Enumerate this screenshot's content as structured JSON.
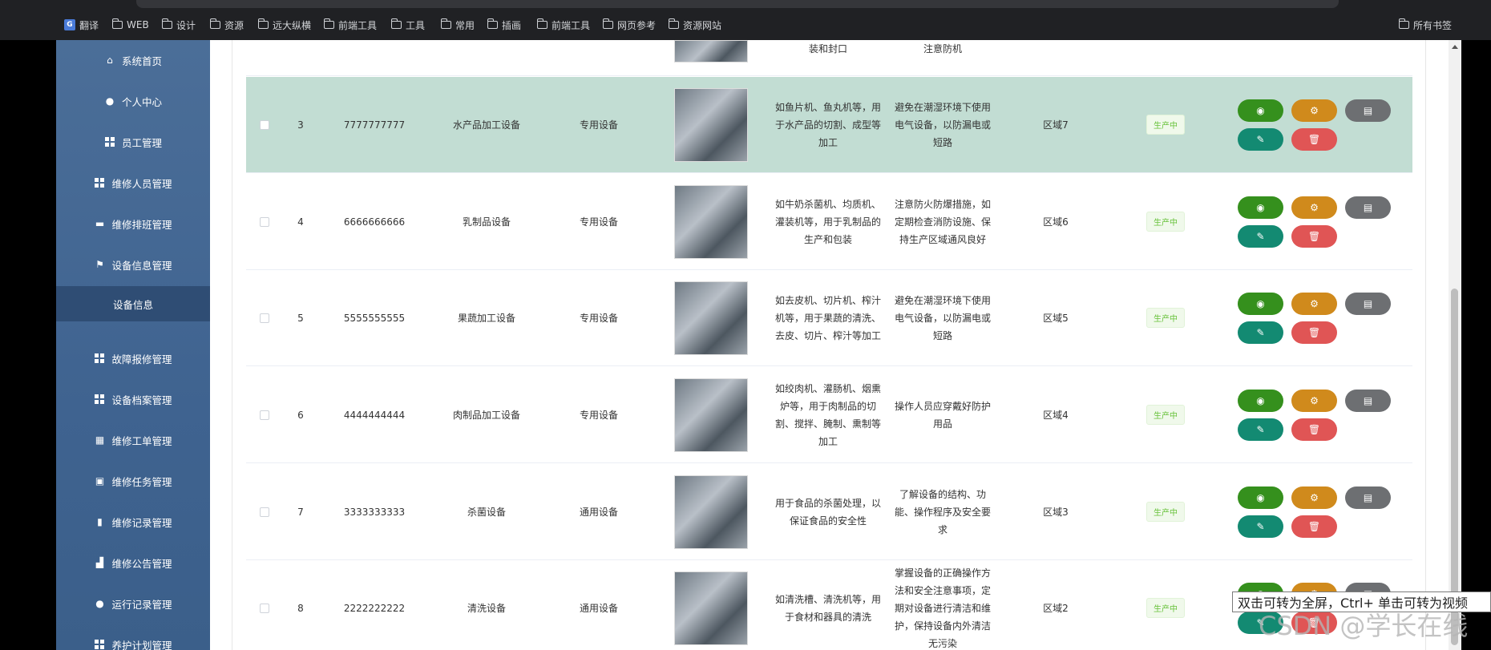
{
  "bookmarks": [
    {
      "label": "翻译",
      "icon": "google-translate-icon"
    },
    {
      "label": "WEB",
      "icon": "folder-icon"
    },
    {
      "label": "设计",
      "icon": "folder-icon"
    },
    {
      "label": "资源",
      "icon": "folder-icon"
    },
    {
      "label": "远大纵横",
      "icon": "folder-icon"
    },
    {
      "label": "前端工具",
      "icon": "folder-icon"
    },
    {
      "label": "工具",
      "icon": "folder-icon"
    },
    {
      "label": "常用",
      "icon": "folder-icon"
    },
    {
      "label": "插画",
      "icon": "folder-icon"
    },
    {
      "label": "前端工具",
      "icon": "folder-icon"
    },
    {
      "label": "网页参考",
      "icon": "folder-icon"
    },
    {
      "label": "资源网站",
      "icon": "folder-icon"
    }
  ],
  "all_bookmarks": "所有书签",
  "sidebar": {
    "items": [
      {
        "label": "系统首页",
        "icon": "home-icon"
      },
      {
        "label": "个人中心",
        "icon": "user-icon"
      },
      {
        "label": "员工管理",
        "icon": "grid-icon"
      },
      {
        "label": "维修人员管理",
        "icon": "grid-icon"
      },
      {
        "label": "维修排班管理",
        "icon": "bus-icon"
      },
      {
        "label": "设备信息管理",
        "icon": "flag-icon"
      },
      {
        "label": "故障报修管理",
        "icon": "grid-icon"
      },
      {
        "label": "设备档案管理",
        "icon": "grid-icon"
      },
      {
        "label": "维修工单管理",
        "icon": "table-icon"
      },
      {
        "label": "维修任务管理",
        "icon": "clipboard-icon"
      },
      {
        "label": "维修记录管理",
        "icon": "book-icon"
      },
      {
        "label": "维修公告管理",
        "icon": "chart-icon"
      },
      {
        "label": "运行记录管理",
        "icon": "user-icon"
      },
      {
        "label": "养护计划管理",
        "icon": "grid-icon"
      }
    ],
    "sub_item": "设备信息"
  },
  "partial_row": {
    "desc": "装和封口",
    "note": "注意防机"
  },
  "rows": [
    {
      "id": "3",
      "code": "7777777777",
      "name": "水产品加工设备",
      "type": "专用设备",
      "desc": "如鱼片机、鱼丸机等，用于水产品的切割、成型等加工",
      "note": "避免在潮湿环境下使用电气设备，以防漏电或短路",
      "area": "区域7",
      "status": "生产中"
    },
    {
      "id": "4",
      "code": "6666666666",
      "name": "乳制品设备",
      "type": "专用设备",
      "desc": "如牛奶杀菌机、均质机、灌装机等，用于乳制品的生产和包装",
      "note": "注意防火防爆措施，如定期检查消防设施、保持生产区域通风良好",
      "area": "区域6",
      "status": "生产中"
    },
    {
      "id": "5",
      "code": "5555555555",
      "name": "果蔬加工设备",
      "type": "专用设备",
      "desc": "如去皮机、切片机、榨汁机等，用于果蔬的清洗、去皮、切片、榨汁等加工",
      "note": "避免在潮湿环境下使用电气设备，以防漏电或短路",
      "area": "区域5",
      "status": "生产中"
    },
    {
      "id": "6",
      "code": "4444444444",
      "name": "肉制品加工设备",
      "type": "专用设备",
      "desc": "如绞肉机、灌肠机、烟熏炉等，用于肉制品的切割、搅拌、腌制、熏制等加工",
      "note": "操作人员应穿戴好防护用品",
      "area": "区域4",
      "status": "生产中"
    },
    {
      "id": "7",
      "code": "3333333333",
      "name": "杀菌设备",
      "type": "通用设备",
      "desc": "用于食品的杀菌处理，以保证食品的安全性",
      "note": "了解设备的结构、功能、操作程序及安全要求",
      "area": "区域3",
      "status": "生产中"
    },
    {
      "id": "8",
      "code": "2222222222",
      "name": "清洗设备",
      "type": "通用设备",
      "desc": "如清洗槽、清洗机等，用于食材和器具的清洗",
      "note": "掌握设备的正确操作方法和安全注意事项，定期对设备进行清洁和维护，保持设备内外清洁无污染",
      "area": "区域2",
      "status": "生产中"
    }
  ],
  "tooltip": "双击可转为全屏，Ctrl+ 单击可转为视频",
  "watermark": "CSDN @学长在线"
}
